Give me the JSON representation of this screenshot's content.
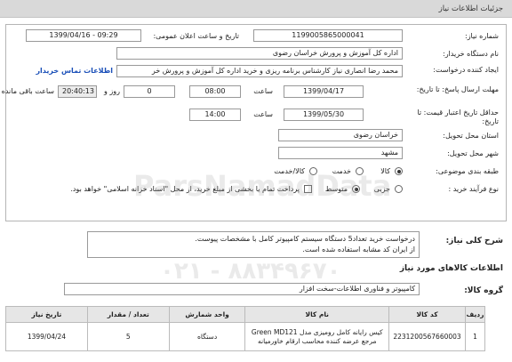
{
  "page_title": "جزئیات اطلاعات نیاز",
  "labels": {
    "need_number": "شماره نیاز:",
    "announce_datetime": "تاریخ و ساعت اعلان عمومی:",
    "buyer_org": "نام دستگاه خریدار:",
    "requester": "ایجاد کننده درخواست:",
    "deadline_send": "مهلت ارسال پاسخ: تا تاریخ:",
    "time_word": "ساعت",
    "day_word": "روز و",
    "remaining": "ساعت باقی مانده",
    "validity": "حداقل تاریخ اعتبار قیمت: تا تاریخ:",
    "province": "استان محل تحویل:",
    "city": "شهر محل تحویل:",
    "category": "طبقه بندی موضوعی:",
    "purchase_type": "نوع فرآیند خرید :"
  },
  "values": {
    "need_number": "1199005865000041",
    "announce_datetime": "1399/04/16 - 09:29",
    "buyer_org": "اداره کل آموزش و پرورش خراسان رضوی",
    "requester": "محمد رضا انصاری نیاز کارشناس برنامه ریزی و خرید اداره کل آموزش و پرورش خر",
    "buyer_contact_link": "اطلاعات تماس خریدار",
    "deadline_date": "1399/04/17",
    "deadline_time": "08:00",
    "days_left": "0",
    "time_left": "20:40:13",
    "validity_date": "1399/05/30",
    "validity_time": "14:00",
    "province": "خراسان رضوی",
    "city": "مشهد"
  },
  "category_options": [
    "کالا",
    "خدمت",
    "کالا/خدمت"
  ],
  "category_selected": "کالا",
  "purchase_options": [
    "جزیی",
    "متوسط"
  ],
  "purchase_selected": "متوسط",
  "payment_note": "پرداخت تمام یا بخشی از مبلغ خرید، از محل \"اسناد خزانه اسلامی\" خواهد بود.",
  "description": {
    "heading": "شرح کلی نیاز:",
    "text_line1": "درخواست خرید تعداد5 دستگاه سیستم کامپیوتر کامل با مشخصات پیوست.",
    "text_line2": "از ایران کد مشابه استفاده شده است."
  },
  "goods_section": {
    "heading": "اطلاعات کالاهای مورد نیاز",
    "group_label": "گروه کالا:",
    "group_value": "کامپیوتر و فناوری اطلاعات-سخت افزار"
  },
  "table": {
    "headers": [
      "ردیف",
      "کد کالا",
      "نام کالا",
      "واحد شمارش",
      "تعداد / مقدار",
      "تاریخ نیاز"
    ],
    "rows": [
      [
        "1",
        "2231200567660003",
        "کیس رایانه کامل رومیزی مدل Green MD121 مرجع عرضه کننده محاسب ارقام خاورمیانه",
        "دستگاه",
        "5",
        "1399/04/24"
      ]
    ]
  },
  "watermark": {
    "line1": "ParsNamadData",
    "line2": "۰۲۱ - ۸۸۳۴۹۶۷۰"
  }
}
